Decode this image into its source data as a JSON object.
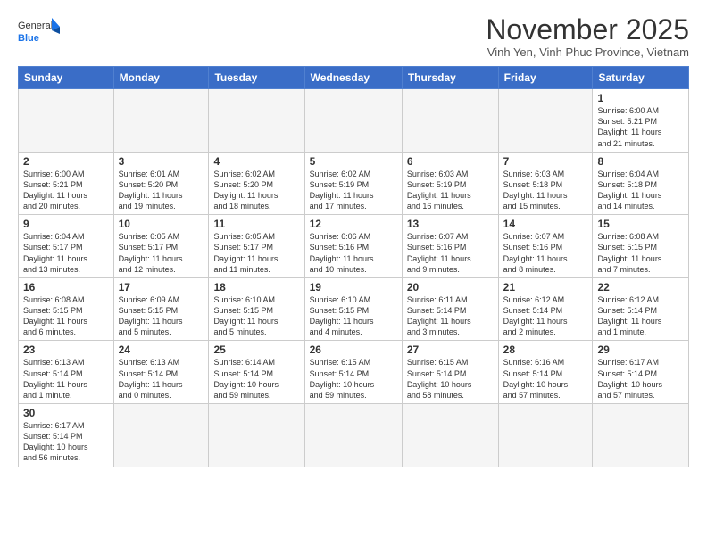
{
  "logo": {
    "text_general": "General",
    "text_blue": "Blue"
  },
  "header": {
    "month": "November 2025",
    "location": "Vinh Yen, Vinh Phuc Province, Vietnam"
  },
  "weekdays": [
    "Sunday",
    "Monday",
    "Tuesday",
    "Wednesday",
    "Thursday",
    "Friday",
    "Saturday"
  ],
  "days": {
    "d1": {
      "num": "1",
      "info": "Sunrise: 6:00 AM\nSunset: 5:21 PM\nDaylight: 11 hours\nand 21 minutes."
    },
    "d2": {
      "num": "2",
      "info": "Sunrise: 6:00 AM\nSunset: 5:21 PM\nDaylight: 11 hours\nand 20 minutes."
    },
    "d3": {
      "num": "3",
      "info": "Sunrise: 6:01 AM\nSunset: 5:20 PM\nDaylight: 11 hours\nand 19 minutes."
    },
    "d4": {
      "num": "4",
      "info": "Sunrise: 6:02 AM\nSunset: 5:20 PM\nDaylight: 11 hours\nand 18 minutes."
    },
    "d5": {
      "num": "5",
      "info": "Sunrise: 6:02 AM\nSunset: 5:19 PM\nDaylight: 11 hours\nand 17 minutes."
    },
    "d6": {
      "num": "6",
      "info": "Sunrise: 6:03 AM\nSunset: 5:19 PM\nDaylight: 11 hours\nand 16 minutes."
    },
    "d7": {
      "num": "7",
      "info": "Sunrise: 6:03 AM\nSunset: 5:18 PM\nDaylight: 11 hours\nand 15 minutes."
    },
    "d8": {
      "num": "8",
      "info": "Sunrise: 6:04 AM\nSunset: 5:18 PM\nDaylight: 11 hours\nand 14 minutes."
    },
    "d9": {
      "num": "9",
      "info": "Sunrise: 6:04 AM\nSunset: 5:17 PM\nDaylight: 11 hours\nand 13 minutes."
    },
    "d10": {
      "num": "10",
      "info": "Sunrise: 6:05 AM\nSunset: 5:17 PM\nDaylight: 11 hours\nand 12 minutes."
    },
    "d11": {
      "num": "11",
      "info": "Sunrise: 6:05 AM\nSunset: 5:17 PM\nDaylight: 11 hours\nand 11 minutes."
    },
    "d12": {
      "num": "12",
      "info": "Sunrise: 6:06 AM\nSunset: 5:16 PM\nDaylight: 11 hours\nand 10 minutes."
    },
    "d13": {
      "num": "13",
      "info": "Sunrise: 6:07 AM\nSunset: 5:16 PM\nDaylight: 11 hours\nand 9 minutes."
    },
    "d14": {
      "num": "14",
      "info": "Sunrise: 6:07 AM\nSunset: 5:16 PM\nDaylight: 11 hours\nand 8 minutes."
    },
    "d15": {
      "num": "15",
      "info": "Sunrise: 6:08 AM\nSunset: 5:15 PM\nDaylight: 11 hours\nand 7 minutes."
    },
    "d16": {
      "num": "16",
      "info": "Sunrise: 6:08 AM\nSunset: 5:15 PM\nDaylight: 11 hours\nand 6 minutes."
    },
    "d17": {
      "num": "17",
      "info": "Sunrise: 6:09 AM\nSunset: 5:15 PM\nDaylight: 11 hours\nand 5 minutes."
    },
    "d18": {
      "num": "18",
      "info": "Sunrise: 6:10 AM\nSunset: 5:15 PM\nDaylight: 11 hours\nand 5 minutes."
    },
    "d19": {
      "num": "19",
      "info": "Sunrise: 6:10 AM\nSunset: 5:15 PM\nDaylight: 11 hours\nand 4 minutes."
    },
    "d20": {
      "num": "20",
      "info": "Sunrise: 6:11 AM\nSunset: 5:14 PM\nDaylight: 11 hours\nand 3 minutes."
    },
    "d21": {
      "num": "21",
      "info": "Sunrise: 6:12 AM\nSunset: 5:14 PM\nDaylight: 11 hours\nand 2 minutes."
    },
    "d22": {
      "num": "22",
      "info": "Sunrise: 6:12 AM\nSunset: 5:14 PM\nDaylight: 11 hours\nand 1 minute."
    },
    "d23": {
      "num": "23",
      "info": "Sunrise: 6:13 AM\nSunset: 5:14 PM\nDaylight: 11 hours\nand 1 minute."
    },
    "d24": {
      "num": "24",
      "info": "Sunrise: 6:13 AM\nSunset: 5:14 PM\nDaylight: 11 hours\nand 0 minutes."
    },
    "d25": {
      "num": "25",
      "info": "Sunrise: 6:14 AM\nSunset: 5:14 PM\nDaylight: 10 hours\nand 59 minutes."
    },
    "d26": {
      "num": "26",
      "info": "Sunrise: 6:15 AM\nSunset: 5:14 PM\nDaylight: 10 hours\nand 59 minutes."
    },
    "d27": {
      "num": "27",
      "info": "Sunrise: 6:15 AM\nSunset: 5:14 PM\nDaylight: 10 hours\nand 58 minutes."
    },
    "d28": {
      "num": "28",
      "info": "Sunrise: 6:16 AM\nSunset: 5:14 PM\nDaylight: 10 hours\nand 57 minutes."
    },
    "d29": {
      "num": "29",
      "info": "Sunrise: 6:17 AM\nSunset: 5:14 PM\nDaylight: 10 hours\nand 57 minutes."
    },
    "d30": {
      "num": "30",
      "info": "Sunrise: 6:17 AM\nSunset: 5:14 PM\nDaylight: 10 hours\nand 56 minutes."
    }
  }
}
